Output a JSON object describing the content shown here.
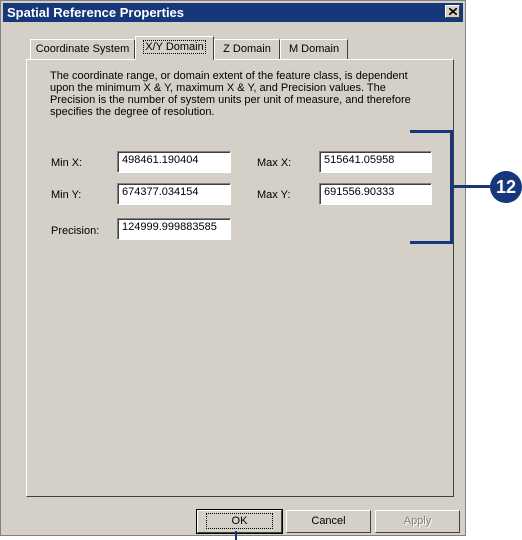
{
  "window": {
    "title": "Spatial Reference Properties"
  },
  "tabs": [
    {
      "label": "Coordinate System",
      "active": false
    },
    {
      "label": "X/Y Domain",
      "active": true
    },
    {
      "label": "Z Domain",
      "active": false
    },
    {
      "label": "M Domain",
      "active": false
    }
  ],
  "domain": {
    "description": "The coordinate range, or domain extent of the feature class, is dependent upon the minimum X & Y, maximum X & Y, and Precision values. The Precision is the number of system units per unit of measure, and therefore specifies the degree of resolution.",
    "min_x_label": "Min X:",
    "min_x_value": "498461.190404",
    "max_x_label": "Max X:",
    "max_x_value": "515641.05958",
    "min_y_label": "Min Y:",
    "min_y_value": "674377.034154",
    "max_y_label": "Max Y:",
    "max_y_value": "691556.90333",
    "precision_label": "Precision:",
    "precision_value": "124999.999883585"
  },
  "buttons": {
    "ok": "OK",
    "cancel": "Cancel",
    "apply": "Apply"
  },
  "callout": {
    "number": "12",
    "color": "#16377a"
  },
  "colors": {
    "titlebar": "#16377a",
    "dialog": "#d4d0c8"
  }
}
